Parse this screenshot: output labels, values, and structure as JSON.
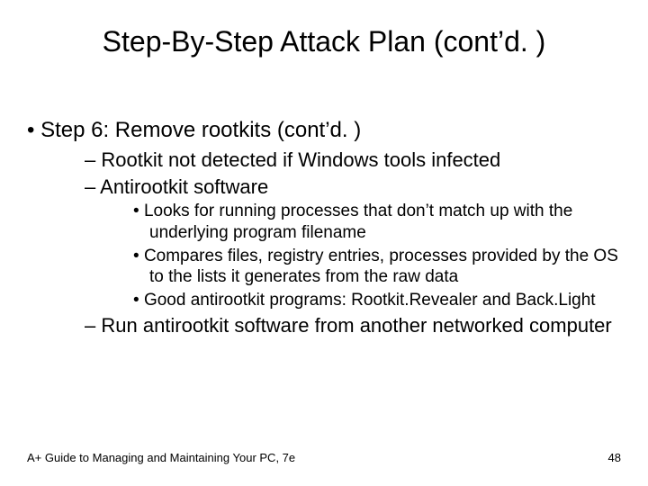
{
  "title": "Step-By-Step Attack Plan (cont’d. )",
  "bullets": {
    "l1_0": "Step 6: Remove rootkits (cont’d. )",
    "l2_0": "Rootkit not detected if Windows tools infected",
    "l2_1": "Antirootkit software",
    "l3_0": "Looks for running processes that don’t match up with the underlying program filename",
    "l3_1": "Compares files, registry entries, processes provided by the OS to the lists it generates from the raw data",
    "l3_2": "Good antirootkit programs: Rootkit.Revealer and Back.Light",
    "l2_2": "Run antirootkit software from another networked computer"
  },
  "footer": {
    "left": "A+ Guide to Managing and Maintaining Your PC, 7e",
    "page": "48"
  }
}
